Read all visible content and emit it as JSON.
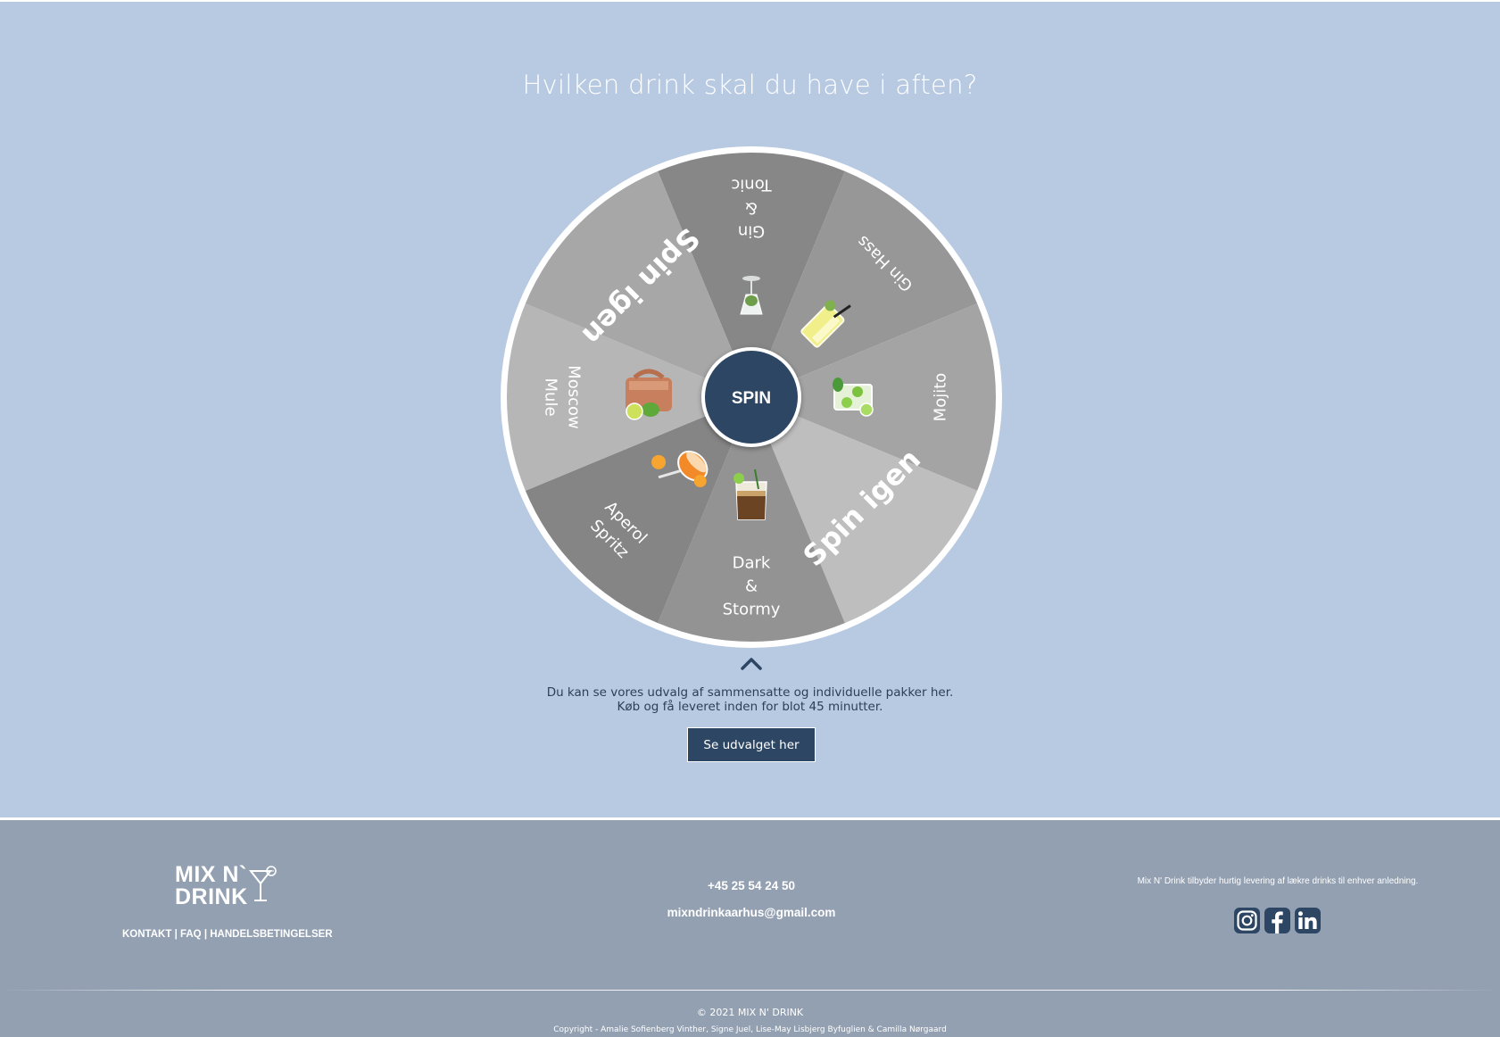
{
  "heading": "Hvilken drink skal du have i aften?",
  "wheel": {
    "segments": [
      {
        "id": "gin-tonic",
        "lines": [
          "Gin",
          "&",
          "Tonic"
        ],
        "color": "#878787",
        "icon": "wine-glass-icon"
      },
      {
        "id": "gin-hass",
        "lines": [
          "Gin Hass"
        ],
        "color": "#979797",
        "icon": "highball-glass-icon"
      },
      {
        "id": "mojito",
        "lines": [
          "Mojito"
        ],
        "color": "#a4a4a4",
        "icon": "mojito-glass-icon"
      },
      {
        "id": "spin-igen-1",
        "lines": [
          "Spin igen"
        ],
        "color": "#bebebe",
        "icon": ""
      },
      {
        "id": "dark-stormy",
        "lines": [
          "Dark",
          "&",
          "Stormy"
        ],
        "color": "#939393",
        "icon": "tumbler-glass-icon"
      },
      {
        "id": "aperol-spritz",
        "lines": [
          "Aperol",
          "Spritz"
        ],
        "color": "#858585",
        "icon": "spritz-glass-icon"
      },
      {
        "id": "moscow-mule",
        "lines": [
          "Moscow",
          "Mule"
        ],
        "color": "#b6b6b6",
        "icon": "copper-mug-icon"
      },
      {
        "id": "spin-igen-2",
        "lines": [
          "Spin igen"
        ],
        "color": "#a7a7a7",
        "icon": ""
      }
    ],
    "spin_label": "SPIN",
    "hub_color": "#2d4663"
  },
  "intro": {
    "line1": "Du kan se vores udvalg af sammensatte og individuelle pakker her.",
    "line2": "Køb og få leveret inden for blot 45 minutter."
  },
  "cta_label": "Se udvalget her",
  "footer": {
    "logo_line1": "MIX N`",
    "logo_line2": "DRINK",
    "links": [
      "KONTAKT",
      "FAQ",
      "HANDELSBETINGELSER"
    ],
    "separator": " | ",
    "phone": "+45 25 54 24 50",
    "email": "mixndrinkaarhus@gmail.com",
    "tagline": "Mix N' Drink tilbyder hurtig levering af lækre drinks til enhver anledning.",
    "socials": [
      "instagram-icon",
      "facebook-icon",
      "linkedin-icon"
    ],
    "copyright": "© 2021 MIX N' DRINK",
    "credits": "Copyright - Amalie Sofienberg Vinther, Signe Juel, Lise-May Lisbjerg Byfuglien & Camilla Nørgaard"
  },
  "colors": {
    "background": "#b8c9e2",
    "footer": "#93a0b2",
    "accent": "#2d4663"
  }
}
